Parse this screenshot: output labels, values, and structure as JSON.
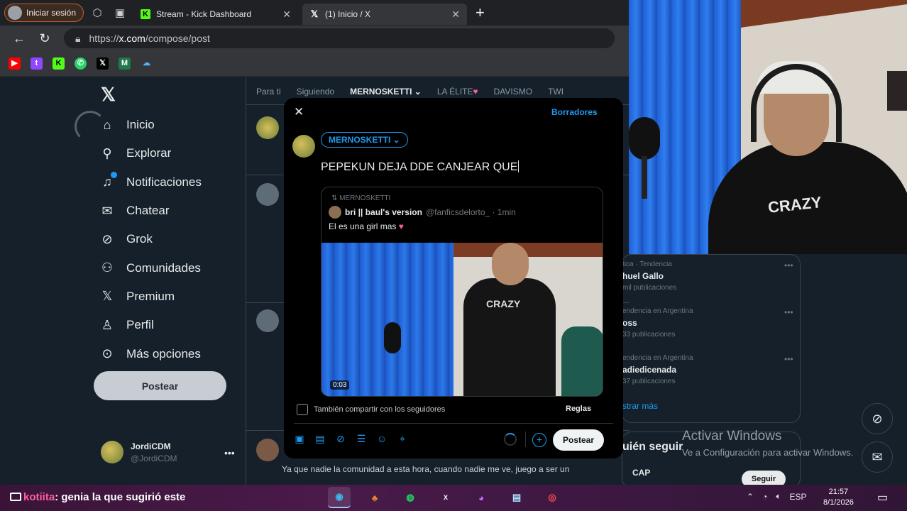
{
  "browser": {
    "signin_label": "Iniciar sesión",
    "tabs": [
      {
        "title": "Stream - Kick Dashboard",
        "favicon": "kick-icon"
      },
      {
        "title": "(1) Inicio / X",
        "favicon": "x-icon"
      }
    ],
    "url_prefix": "https://",
    "url_host": "x.com",
    "url_path": "/compose/post",
    "bookmarks": [
      "youtube-icon",
      "twitch-icon",
      "kick-icon",
      "whatsapp-icon",
      "x-icon",
      "app-icon",
      "cloud-icon"
    ]
  },
  "colors": {
    "x_accent": "#1d9bf0",
    "x_bg": "#15202b",
    "modal_bg": "#000000",
    "taskbar": "#4a1a4a"
  },
  "nav": {
    "items": [
      {
        "label": "Inicio",
        "icon": "home-icon"
      },
      {
        "label": "Explorar",
        "icon": "search-icon"
      },
      {
        "label": "Notificaciones",
        "icon": "bell-icon"
      },
      {
        "label": "Chatear",
        "icon": "mail-icon"
      },
      {
        "label": "Grok",
        "icon": "grok-icon"
      },
      {
        "label": "Comunidades",
        "icon": "people-icon"
      },
      {
        "label": "Premium",
        "icon": "x-icon"
      },
      {
        "label": "Perfil",
        "icon": "person-icon"
      },
      {
        "label": "Más opciones",
        "icon": "more-circle-icon"
      }
    ],
    "post_label": "Postear",
    "profile_name": "JordiCDM",
    "profile_handle": "@JordiCDM"
  },
  "timeline": {
    "tabs": [
      "Para ti",
      "Siguiendo",
      "MERNOSKETTI",
      "LA ÉLITE",
      "DAVISMO",
      "TWI"
    ],
    "snippet": "Ya que nadie la comunidad a esta hora, cuando nadie me ve, juego a ser un"
  },
  "right": {
    "trends": [
      {
        "sub": "tica · Tendencia",
        "name": "huel Gallo",
        "count": "mil publicaciones"
      },
      {
        "sub": "endencia en Argentina",
        "name": "oss",
        "count": "33 publicaciones"
      },
      {
        "sub": "endencia en Argentina",
        "name": "adiedicenada",
        "count": "37 publicaciones"
      }
    ],
    "show_more": "strar más",
    "who_to_follow": "uién seguir",
    "follow_suggestion": "CAP",
    "follow_label": "Seguir",
    "activate_title": "Activar Windows",
    "activate_sub": "Ve a Configuración para activar Windows."
  },
  "compose": {
    "drafts_label": "Borradores",
    "audience": "MERNOSKETTI",
    "text": "PEPEKUN DEJA DDE CANJEAR QUE",
    "quote": {
      "repost_label": "MERNOSKETTI",
      "name": "bri || baul's version",
      "handle": "@fanficsdelorto_ · 1min",
      "text": "El es una girl mas",
      "video_time": "0:03"
    },
    "share_label": "También compartir con los seguidores",
    "rules_label": "Reglas",
    "post_label": "Postear"
  },
  "stream": {
    "chat_user": "kotiita",
    "chat_message": ": genia la que sugirió este",
    "shirt_text": "CRAZY"
  },
  "taskbar": {
    "language": "ESP",
    "time": "21:57",
    "date": "8/1/2026"
  }
}
